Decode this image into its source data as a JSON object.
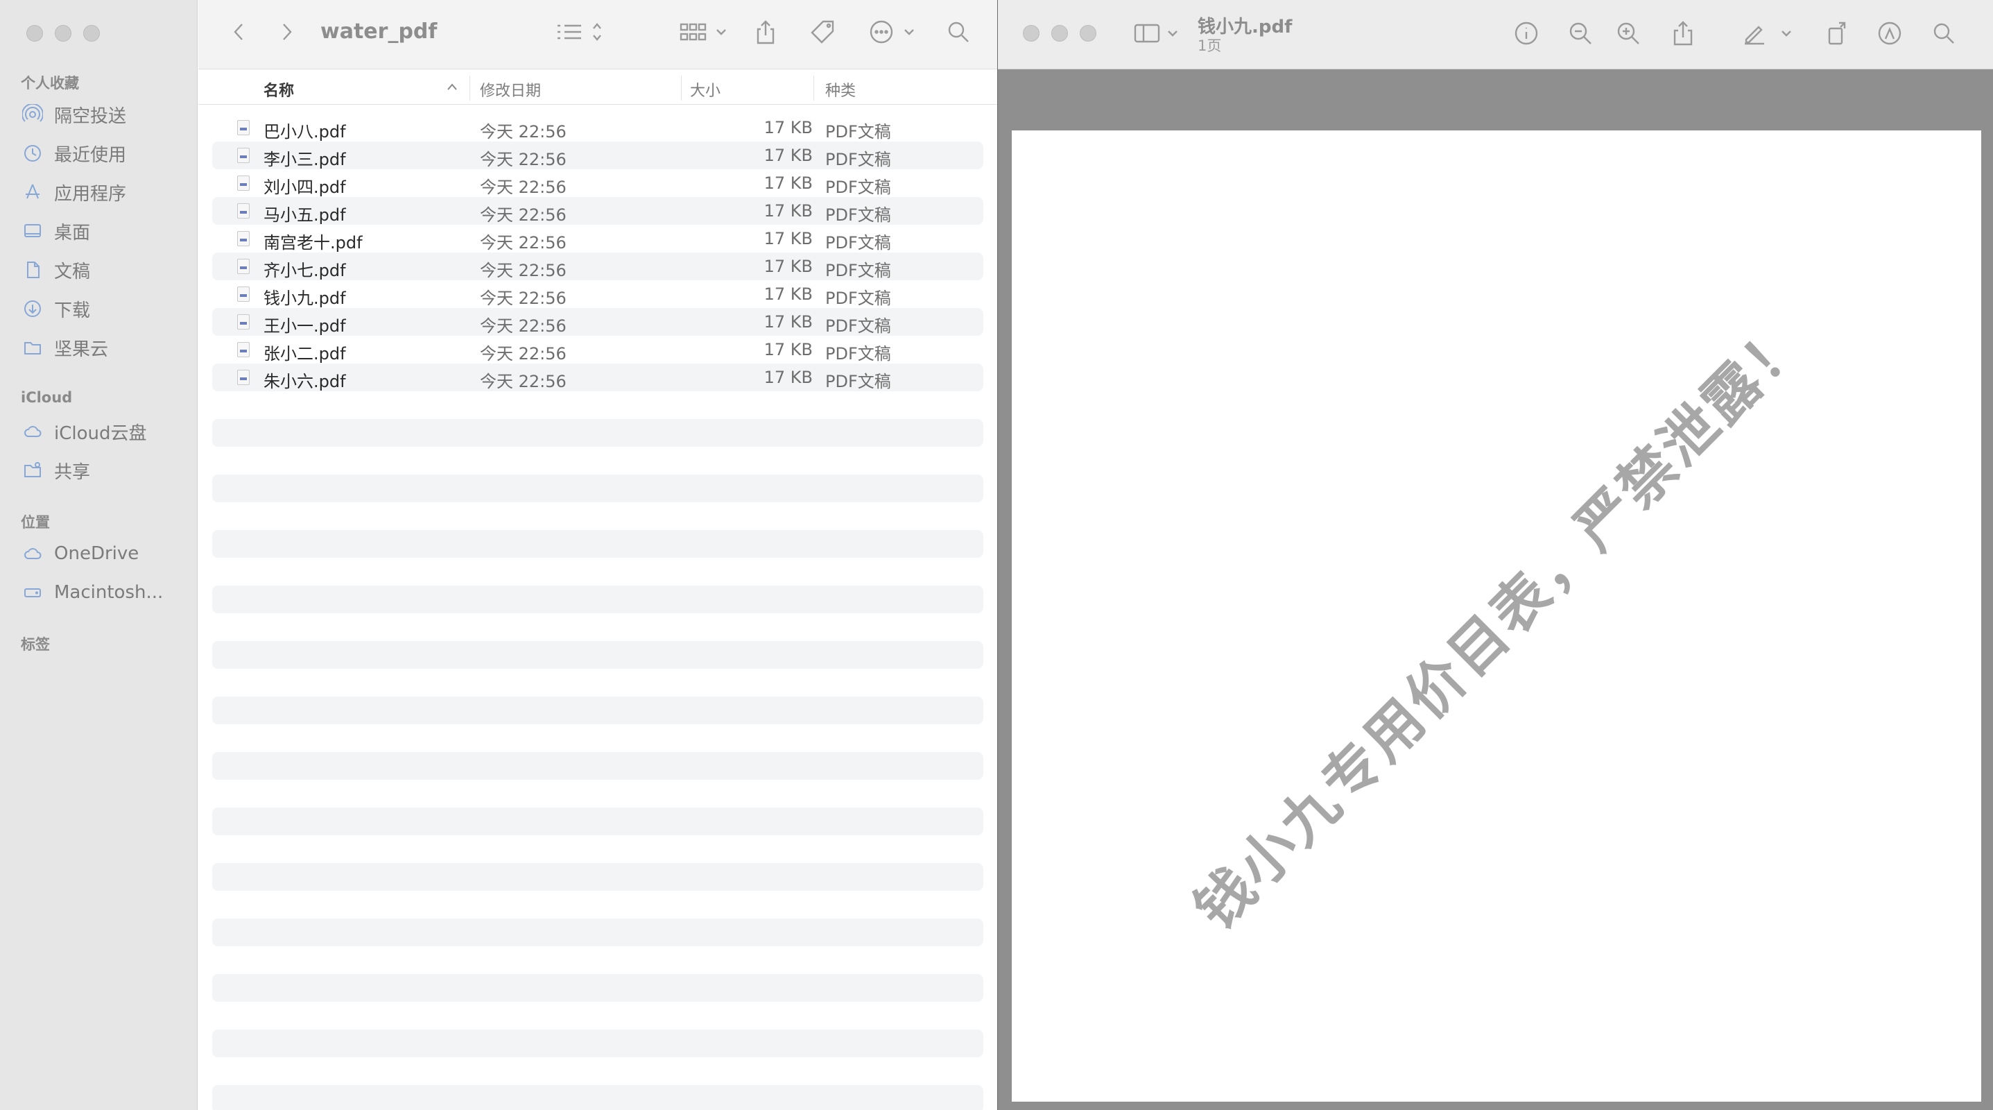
{
  "finder": {
    "title": "water_pdf",
    "sidebar": {
      "favorites_label": "个人收藏",
      "favorites": [
        {
          "label": "隔空投送",
          "icon": "airdrop-icon"
        },
        {
          "label": "最近使用",
          "icon": "clock-icon"
        },
        {
          "label": "应用程序",
          "icon": "applications-icon"
        },
        {
          "label": "桌面",
          "icon": "desktop-icon"
        },
        {
          "label": "文稿",
          "icon": "document-icon"
        },
        {
          "label": "下载",
          "icon": "download-icon"
        },
        {
          "label": "坚果云",
          "icon": "folder-icon"
        }
      ],
      "icloud_label": "iCloud",
      "icloud": [
        {
          "label": "iCloud云盘",
          "icon": "cloud-icon"
        },
        {
          "label": "共享",
          "icon": "shared-folder-icon"
        }
      ],
      "locations_label": "位置",
      "locations": [
        {
          "label": "OneDrive",
          "icon": "cloud-icon"
        },
        {
          "label": "Macintosh...",
          "icon": "disk-icon"
        }
      ],
      "tags_label": "标签"
    },
    "columns": {
      "name": "名称",
      "date": "修改日期",
      "size": "大小",
      "kind": "种类"
    },
    "files": [
      {
        "name": "巴小八.pdf",
        "date": "今天 22:56",
        "size": "17 KB",
        "kind": "PDF文稿"
      },
      {
        "name": "李小三.pdf",
        "date": "今天 22:56",
        "size": "17 KB",
        "kind": "PDF文稿"
      },
      {
        "name": "刘小四.pdf",
        "date": "今天 22:56",
        "size": "17 KB",
        "kind": "PDF文稿"
      },
      {
        "name": "马小五.pdf",
        "date": "今天 22:56",
        "size": "17 KB",
        "kind": "PDF文稿"
      },
      {
        "name": "南宫老十.pdf",
        "date": "今天 22:56",
        "size": "17 KB",
        "kind": "PDF文稿"
      },
      {
        "name": "齐小七.pdf",
        "date": "今天 22:56",
        "size": "17 KB",
        "kind": "PDF文稿"
      },
      {
        "name": "钱小九.pdf",
        "date": "今天 22:56",
        "size": "17 KB",
        "kind": "PDF文稿"
      },
      {
        "name": "王小一.pdf",
        "date": "今天 22:56",
        "size": "17 KB",
        "kind": "PDF文稿"
      },
      {
        "name": "张小二.pdf",
        "date": "今天 22:56",
        "size": "17 KB",
        "kind": "PDF文稿"
      },
      {
        "name": "朱小六.pdf",
        "date": "今天 22:56",
        "size": "17 KB",
        "kind": "PDF文稿"
      }
    ]
  },
  "preview": {
    "title": "钱小九.pdf",
    "subtitle": "1页",
    "watermark": "钱小九专用价目表，严禁泄露！"
  },
  "colors": {
    "sidebar_icon": "#87a7d6",
    "row_stripe": "#f3f4f5",
    "watermark": "#a7a7a7"
  }
}
